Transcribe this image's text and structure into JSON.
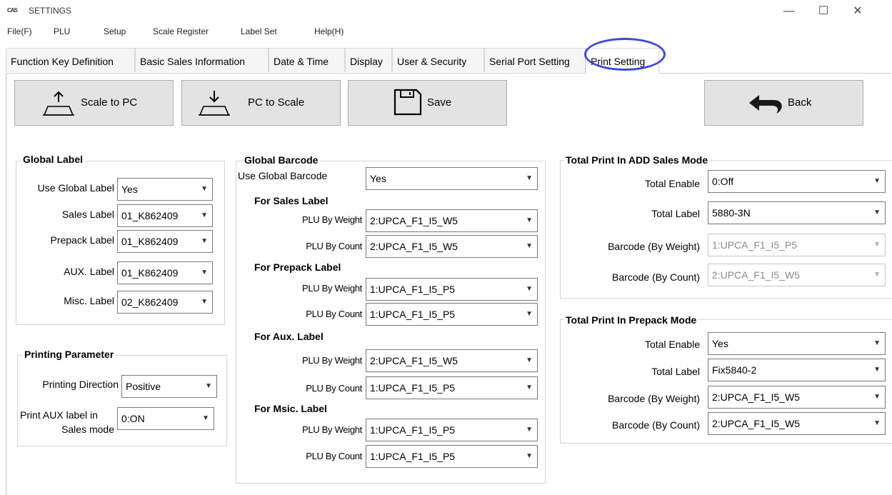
{
  "window": {
    "icon_text": "CAS",
    "title": "SETTINGS",
    "minimize": "—",
    "maximize": "☐",
    "close": "✕"
  },
  "menu": [
    "File(F)",
    "PLU",
    "Setup",
    "Scale Register",
    "Label Set",
    "Help(H)"
  ],
  "tabs": [
    "Function Key Definition",
    "Basic Sales Information",
    "Date & Time",
    "Display",
    "User & Security",
    "Serial Port Setting",
    "Print Setting"
  ],
  "toolbar": {
    "scale_to_pc": "Scale to PC",
    "pc_to_scale": "PC to Scale",
    "save": "Save",
    "back": "Back"
  },
  "global_label": {
    "title": "Global Label",
    "use_global_label": {
      "label": "Use Global Label",
      "value": "Yes"
    },
    "sales_label": {
      "label": "Sales Label",
      "value": "01_K862409"
    },
    "prepack_label": {
      "label": "Prepack Label",
      "value": "01_K862409"
    },
    "aux_label": {
      "label": "AUX. Label",
      "value": "01_K862409"
    },
    "misc_label": {
      "label": "Misc. Label",
      "value": "02_K862409"
    }
  },
  "printing_parameter": {
    "title": "Printing Parameter",
    "direction": {
      "label": "Printing Direction",
      "value": "Positive"
    },
    "aux_in_sales": {
      "label_line1": "Print AUX label in",
      "label_line2": "Sales mode",
      "value": "0:ON"
    }
  },
  "global_barcode": {
    "title": "Global Barcode",
    "use_global_barcode": {
      "label": "Use Global Barcode",
      "value": "Yes"
    },
    "sales": {
      "title": "For Sales Label",
      "by_weight": {
        "label": "PLU By Weight",
        "value": "2:UPCA_F1_I5_W5"
      },
      "by_count": {
        "label": "PLU By Count",
        "value": "2:UPCA_F1_I5_W5"
      }
    },
    "prepack": {
      "title": "For Prepack Label",
      "by_weight": {
        "label": "PLU By Weight",
        "value": "1:UPCA_F1_I5_P5"
      },
      "by_count": {
        "label": "PLU By Count",
        "value": "1:UPCA_F1_I5_P5"
      }
    },
    "aux": {
      "title": "For Aux. Label",
      "by_weight": {
        "label": "PLU By Weight",
        "value": "2:UPCA_F1_I5_W5"
      },
      "by_count": {
        "label": "PLU By Count",
        "value": "1:UPCA_F1_I5_P5"
      }
    },
    "misc": {
      "title": "For Msic. Label",
      "by_weight": {
        "label": "PLU By Weight",
        "value": "1:UPCA_F1_I5_P5"
      },
      "by_count": {
        "label": "PLU By Count",
        "value": "1:UPCA_F1_I5_P5"
      }
    }
  },
  "total_add_sales": {
    "title": "Total Print In ADD Sales Mode",
    "enable": {
      "label": "Total Enable",
      "value": "0:Off"
    },
    "total_label": {
      "label": "Total Label",
      "value": "5880-3N"
    },
    "barcode_weight": {
      "label": "Barcode (By Weight)",
      "value": "1:UPCA_F1_I5_P5"
    },
    "barcode_count": {
      "label": "Barcode (By Count)",
      "value": "2:UPCA_F1_I5_W5"
    }
  },
  "total_prepack": {
    "title": "Total Print In Prepack Mode",
    "enable": {
      "label": "Total Enable",
      "value": "Yes"
    },
    "total_label": {
      "label": "Total Label",
      "value": "Fix5840-2"
    },
    "barcode_weight": {
      "label": "Barcode (By Weight)",
      "value": "2:UPCA_F1_I5_W5"
    },
    "barcode_count": {
      "label": "Barcode (By Count)",
      "value": "2:UPCA_F1_I5_W5"
    }
  },
  "colors": {
    "accent_ring": "#3d4ad8",
    "button_face": "#e3e3e3",
    "back_arrow": "#1a1a1a"
  }
}
